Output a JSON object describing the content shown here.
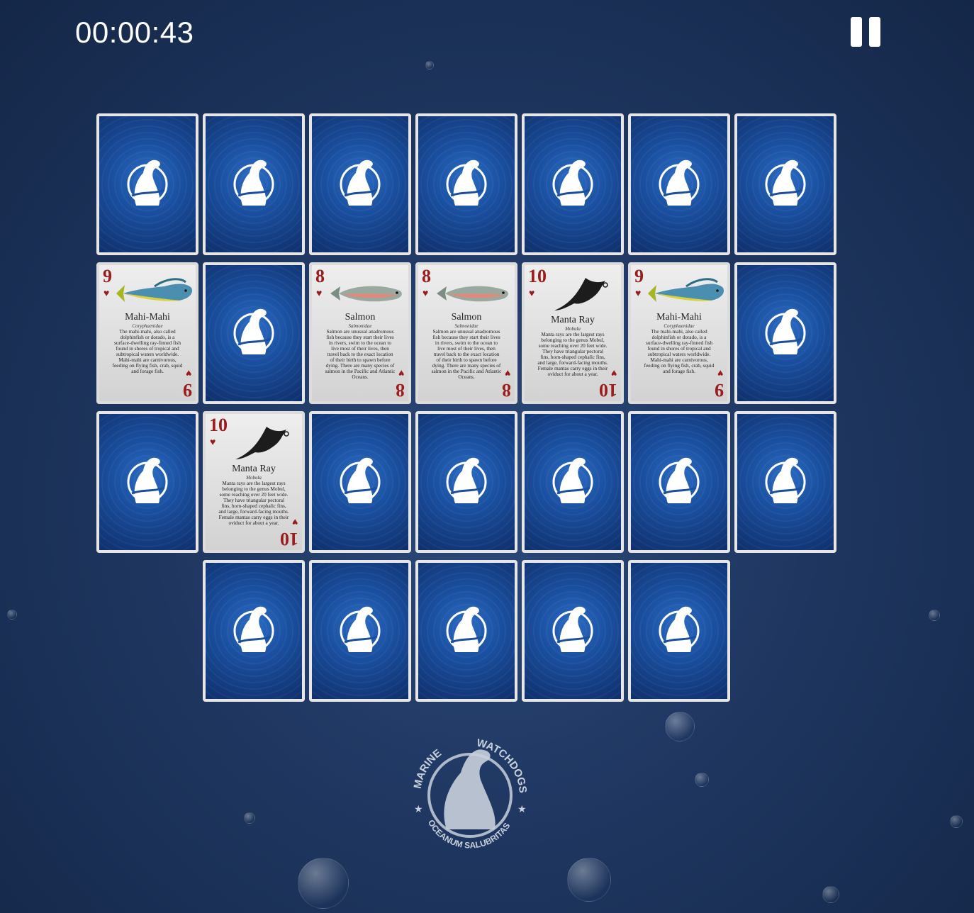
{
  "timer": "00:00:43",
  "pause_label": "Pause",
  "bottom_logo": {
    "top_left": "MARINE",
    "top_right": "WATCHDOGS",
    "motto": "OCEANUM SALUBRITAS"
  },
  "back_logo_text": {
    "a": "MARINE",
    "b": "WATCHDOGS"
  },
  "cards": [
    {
      "state": "back"
    },
    {
      "state": "back"
    },
    {
      "state": "back"
    },
    {
      "state": "back"
    },
    {
      "state": "back"
    },
    {
      "state": "back"
    },
    {
      "state": "back"
    },
    {
      "state": "face",
      "rank": "9",
      "suit": "♥",
      "name": "Mahi-Mahi",
      "scientific": "Coryphaenidae",
      "description": "The mahi-mahi, also called dolphinfish or dorado, is a surface-dwelling ray-finned fish found in shores of tropical and subtropical waters worldwide. Mahi-mahi are carnivorous, feeding on flying fish, crab, squid and forage fish.",
      "art": "mahi-mahi-icon"
    },
    {
      "state": "back"
    },
    {
      "state": "face",
      "rank": "8",
      "suit": "♥",
      "name": "Salmon",
      "scientific": "Salmonidae",
      "description": "Salmon are unusual anadromous fish because they start their lives in rivers, swim to the ocean to live most of their lives, then travel back to the exact location of their birth to spawn before dying. There are many species of salmon in the Pacific and Atlantic Oceans.",
      "art": "salmon-icon"
    },
    {
      "state": "face",
      "rank": "8",
      "suit": "♥",
      "name": "Salmon",
      "scientific": "Salmonidae",
      "description": "Salmon are unusual anadromous fish because they start their lives in rivers, swim to the ocean to live most of their lives, then travel back to the exact location of their birth to spawn before dying. There are many species of salmon in the Pacific and Atlantic Oceans.",
      "art": "salmon-icon"
    },
    {
      "state": "face",
      "rank": "10",
      "suit": "♥",
      "name": "Manta Ray",
      "scientific": "Mobula",
      "description": "Manta rays are the largest rays belonging to the genus Mobul, some reaching over 20 feet wide. They have triangular pectoral fins, horn-shaped cephalic fins, and large, forward-facing mouths. Female mantas carry eggs in their oviduct for about a year.",
      "art": "manta-ray-icon"
    },
    {
      "state": "face",
      "rank": "9",
      "suit": "♥",
      "name": "Mahi-Mahi",
      "scientific": "Coryphaenidae",
      "description": "The mahi-mahi, also called dolphinfish or dorado, is a surface-dwelling ray-finned fish found in shores of tropical and subtropical waters worldwide. Mahi-mahi are carnivorous, feeding on flying fish, crab, squid and forage fish.",
      "art": "mahi-mahi-icon"
    },
    {
      "state": "back"
    },
    {
      "state": "back"
    },
    {
      "state": "face",
      "rank": "10",
      "suit": "♥",
      "name": "Manta Ray",
      "scientific": "Mobula",
      "description": "Manta rays are the largest rays belonging to the genus Mobul, some reaching over 20 feet wide. They have triangular pectoral fins, horn-shaped cephalic fins, and large, forward-facing mouths. Female mantas carry eggs in their oviduct for about a year.",
      "art": "manta-ray-icon"
    },
    {
      "state": "back"
    },
    {
      "state": "back"
    },
    {
      "state": "back"
    },
    {
      "state": "back"
    },
    {
      "state": "back"
    },
    {
      "state": "back"
    },
    {
      "state": "back"
    },
    {
      "state": "back"
    },
    {
      "state": "back"
    },
    {
      "state": "back"
    }
  ]
}
